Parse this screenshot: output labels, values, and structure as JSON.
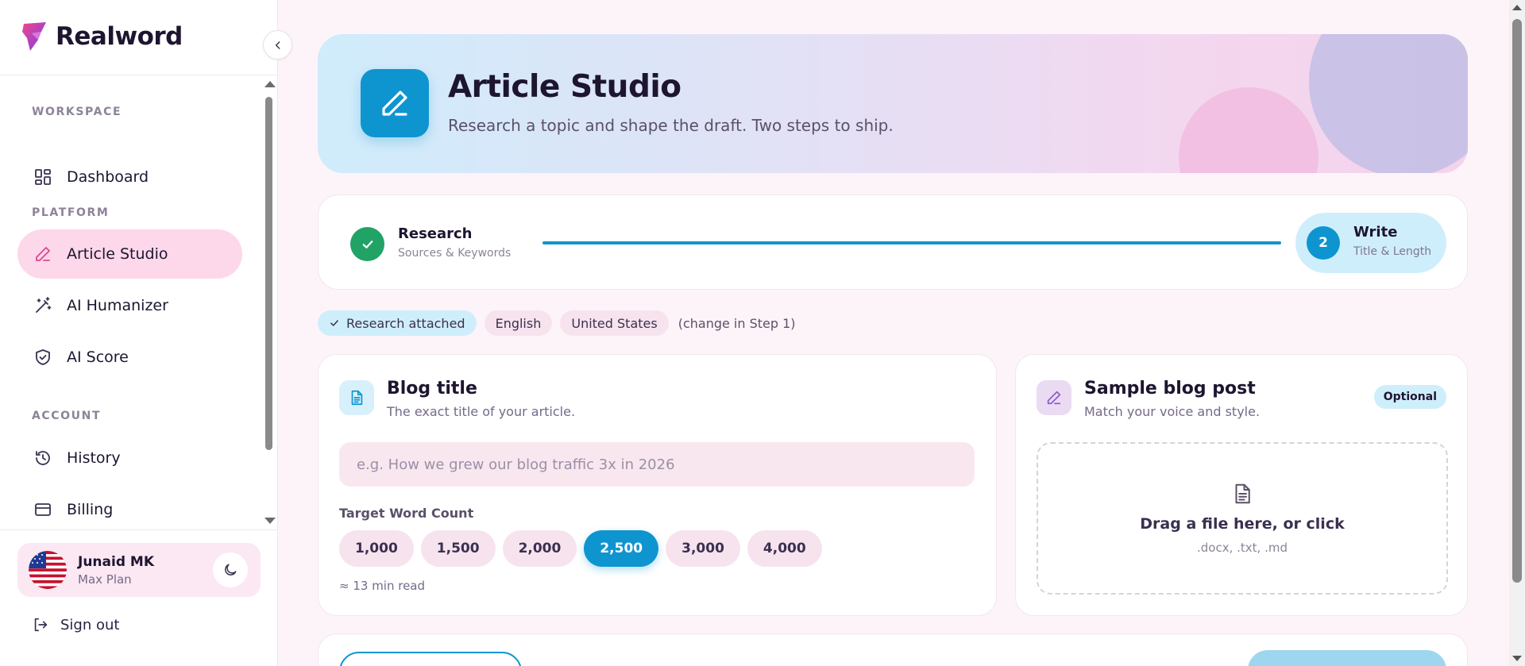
{
  "brand": {
    "name": "Realword"
  },
  "sidebar": {
    "sections": {
      "workspace": "WORKSPACE",
      "platform": "PLATFORM",
      "account": "ACCOUNT"
    },
    "items": [
      {
        "label": "Dashboard",
        "icon": "dashboard-icon"
      },
      {
        "label": "Article Studio",
        "icon": "pen-icon",
        "active": true
      },
      {
        "label": "AI Humanizer",
        "icon": "magic-wand-icon"
      },
      {
        "label": "AI Score",
        "icon": "shield-check-icon"
      },
      {
        "label": "History",
        "icon": "history-icon"
      },
      {
        "label": "Billing",
        "icon": "credit-card-icon"
      }
    ],
    "user": {
      "name": "Junaid MK",
      "plan": "Max Plan"
    },
    "signout": "Sign out"
  },
  "hero": {
    "title": "Article Studio",
    "subtitle": "Research a topic and shape the draft. Two steps to ship."
  },
  "stepper": {
    "step1": {
      "title": "Research",
      "subtitle": "Sources & Keywords",
      "status": "complete"
    },
    "step2": {
      "number": "2",
      "title": "Write",
      "subtitle": "Title & Length",
      "status": "active"
    }
  },
  "chips": {
    "research": "Research attached",
    "language": "English",
    "country": "United States",
    "note": "(change in Step 1)"
  },
  "blog_title_card": {
    "title": "Blog title",
    "subtitle": "The exact title of your article.",
    "input_value": "",
    "input_placeholder": "e.g. How we grew our blog traffic 3x in 2026",
    "word_count_label": "Target Word Count",
    "word_counts": [
      "1,000",
      "1,500",
      "2,000",
      "2,500",
      "3,000",
      "4,000"
    ],
    "selected_word_count": "2,500",
    "read_time": "≈ 13 min read"
  },
  "sample_card": {
    "title": "Sample blog post",
    "subtitle": "Match your voice and style.",
    "badge": "Optional",
    "drop_text": "Drag a file here, or click",
    "file_types": ".docx, .txt, .md"
  },
  "colors": {
    "accent": "#0e95d0",
    "active_nav_bg": "#fdd7ea",
    "success": "#21a366",
    "input_bg": "#f9e7f0"
  }
}
